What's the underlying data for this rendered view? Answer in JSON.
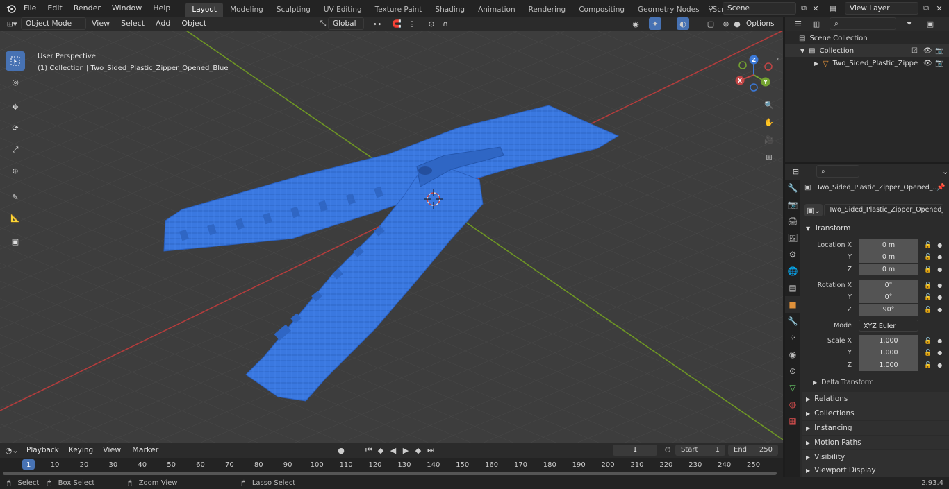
{
  "menubar": {
    "items": [
      "File",
      "Edit",
      "Render",
      "Window",
      "Help"
    ],
    "workspaces": [
      "Layout",
      "Modeling",
      "Sculpting",
      "UV Editing",
      "Texture Paint",
      "Shading",
      "Animation",
      "Rendering",
      "Compositing",
      "Geometry Nodes",
      "Scripting"
    ],
    "active_workspace": "Layout",
    "scene_name": "Scene",
    "view_layer_name": "View Layer"
  },
  "viewport_header": {
    "mode": "Object Mode",
    "menus": [
      "View",
      "Select",
      "Add",
      "Object"
    ],
    "orientation": "Global",
    "options_label": "Options"
  },
  "viewport": {
    "perspective_label": "User Perspective",
    "collection_label": "(1) Collection | Two_Sided_Plastic_Zipper_Opened_Blue",
    "gizmo_axes": [
      "X",
      "Y",
      "Z"
    ],
    "object_color": "#3a78e0",
    "x_axis_color": "#b43c3c",
    "y_axis_color": "#6e9624"
  },
  "outliner": {
    "root": "Scene Collection",
    "collection": "Collection",
    "object": "Two_Sided_Plastic_Zippe"
  },
  "properties": {
    "object_title": "Two_Sided_Plastic_Zipper_Opened_...",
    "object_name": "Two_Sided_Plastic_Zipper_Opened_Blue",
    "transform_label": "Transform",
    "location_label": "Location X",
    "rotation_label": "Rotation X",
    "scale_label": "Scale X",
    "axis_y": "Y",
    "axis_z": "Z",
    "location": [
      "0 m",
      "0 m",
      "0 m"
    ],
    "rotation": [
      "0°",
      "0°",
      "90°"
    ],
    "mode_label": "Mode",
    "mode_value": "XYZ Euler",
    "scale": [
      "1.000",
      "1.000",
      "1.000"
    ],
    "delta_transform": "Delta Transform",
    "panels": [
      "Relations",
      "Collections",
      "Instancing",
      "Motion Paths",
      "Visibility",
      "Viewport Display"
    ]
  },
  "timeline": {
    "menus": [
      "Playback",
      "Keying",
      "View",
      "Marker"
    ],
    "current_frame": "1",
    "start_label": "Start",
    "start_value": "1",
    "end_label": "End",
    "end_value": "250",
    "ticks": [
      "1",
      "10",
      "20",
      "30",
      "40",
      "50",
      "60",
      "70",
      "80",
      "90",
      "100",
      "110",
      "120",
      "130",
      "140",
      "150",
      "160",
      "170",
      "180",
      "190",
      "200",
      "210",
      "220",
      "230",
      "240",
      "250"
    ]
  },
  "statusbar": {
    "select": "Select",
    "box_select": "Box Select",
    "zoom_view": "Zoom View",
    "lasso_select": "Lasso Select",
    "version": "2.93.4"
  }
}
